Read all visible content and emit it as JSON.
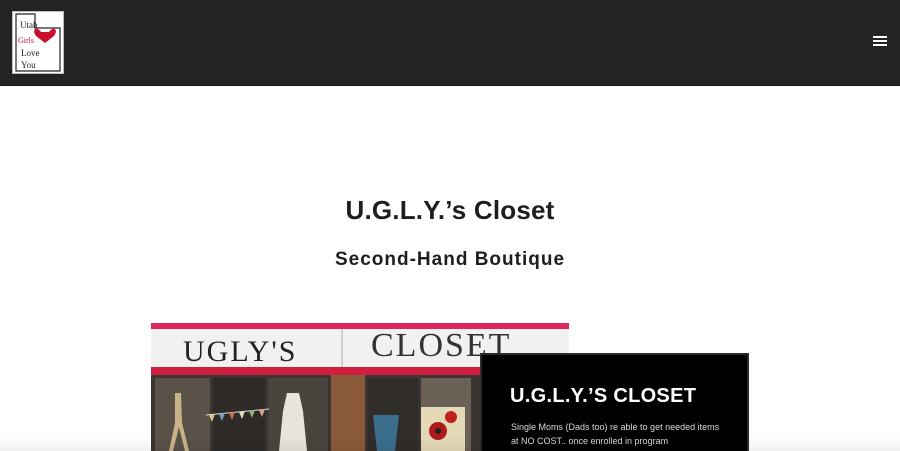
{
  "header": {
    "logo_lines": [
      "Utah",
      "Girls",
      "Love",
      "You"
    ],
    "menu_icon": "hamburger-menu-icon"
  },
  "main": {
    "title": "U.G.L.Y.’s Closet",
    "subtitle": "Second-Hand Boutique"
  },
  "photo": {
    "sign_left": "UGLY'S",
    "sign_right": "CLOSET"
  },
  "card": {
    "title": "U.G.L.Y.’S CLOSET",
    "text": "Single Moms (Dads too) re able to get needed items at NO COST.. once enrolled in program"
  },
  "colors": {
    "header_bg": "#232323",
    "accent_red": "#c8102e",
    "card_bg": "#000000"
  }
}
